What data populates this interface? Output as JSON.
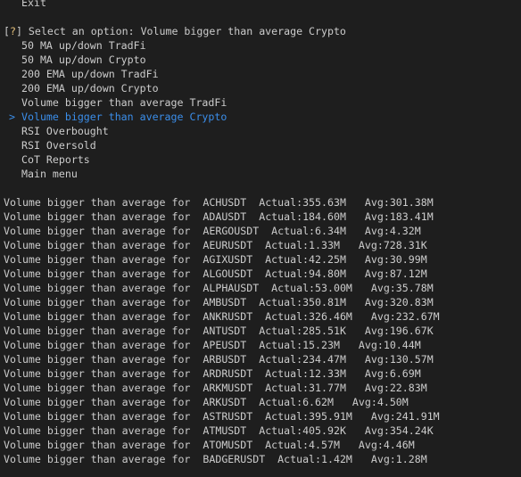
{
  "menu": {
    "exit_label": "Exit",
    "prompt_bracket_open": "[",
    "prompt_mark": "?",
    "prompt_bracket_close": "]",
    "prompt_text": " Select an option: Volume bigger than average Crypto",
    "pointer": ">",
    "options": [
      {
        "label": "50 MA up/down TradFi",
        "selected": false
      },
      {
        "label": "50 MA up/down Crypto",
        "selected": false
      },
      {
        "label": "200 EMA up/down TradFi",
        "selected": false
      },
      {
        "label": "200 EMA up/down Crypto",
        "selected": false
      },
      {
        "label": "Volume bigger than average TradFi",
        "selected": false
      },
      {
        "label": "Volume bigger than average Crypto",
        "selected": true
      },
      {
        "label": "RSI Overbought",
        "selected": false
      },
      {
        "label": "RSI Oversold",
        "selected": false
      },
      {
        "label": "CoT Reports",
        "selected": false
      },
      {
        "label": "Main menu",
        "selected": false
      }
    ]
  },
  "results": {
    "prefix": "Volume bigger than average for  ",
    "rows": [
      {
        "symbol": "ACHUSDT",
        "actual": "355.63M",
        "avg": "301.38M"
      },
      {
        "symbol": "ADAUSDT",
        "actual": "184.60M",
        "avg": "183.41M"
      },
      {
        "symbol": "AERGOUSDT",
        "actual": "6.34M",
        "avg": "4.32M"
      },
      {
        "symbol": "AEURUSDT",
        "actual": "1.33M",
        "avg": "728.31K"
      },
      {
        "symbol": "AGIXUSDT",
        "actual": "42.25M",
        "avg": "30.99M"
      },
      {
        "symbol": "ALGOUSDT",
        "actual": "94.80M",
        "avg": "87.12M"
      },
      {
        "symbol": "ALPHAUSDT",
        "actual": "53.00M",
        "avg": "35.78M"
      },
      {
        "symbol": "AMBUSDT",
        "actual": "350.81M",
        "avg": "320.83M"
      },
      {
        "symbol": "ANKRUSDT",
        "actual": "326.46M",
        "avg": "232.67M"
      },
      {
        "symbol": "ANTUSDT",
        "actual": "285.51K",
        "avg": "196.67K"
      },
      {
        "symbol": "APEUSDT",
        "actual": "15.23M",
        "avg": "10.44M"
      },
      {
        "symbol": "ARBUSDT",
        "actual": "234.47M",
        "avg": "130.57M"
      },
      {
        "symbol": "ARDRUSDT",
        "actual": "12.33M",
        "avg": "6.69M"
      },
      {
        "symbol": "ARKMUSDT",
        "actual": "31.77M",
        "avg": "22.83M"
      },
      {
        "symbol": "ARKUSDT",
        "actual": "6.62M",
        "avg": "4.50M"
      },
      {
        "symbol": "ASTRUSDT",
        "actual": "395.91M",
        "avg": "241.91M"
      },
      {
        "symbol": "ATMUSDT",
        "actual": "405.92K",
        "avg": "354.24K"
      },
      {
        "symbol": "ATOMUSDT",
        "actual": "4.57M",
        "avg": "4.46M"
      },
      {
        "symbol": "BADGERUSDT",
        "actual": "1.42M",
        "avg": "1.28M"
      }
    ]
  }
}
